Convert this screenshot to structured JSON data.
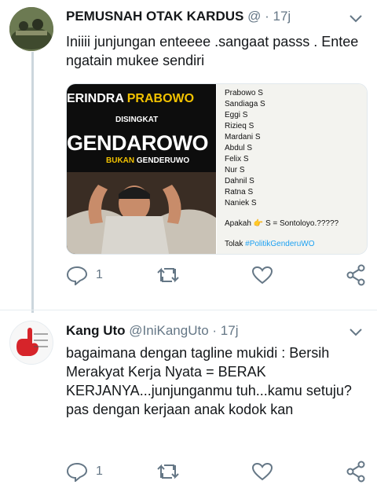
{
  "tweets": [
    {
      "display_name": "PEMUSNAH OTAK KARDUS",
      "handle": "@",
      "sep": "·",
      "time": "17j",
      "text": "Iniiii junjungan enteeee .sangaat passs . Entee ngatain mukee sendiri",
      "media": {
        "left": {
          "erindra": "ERINDRA ",
          "prabowo": "PRABOWO",
          "disingkat": "DISINGKAT",
          "main": "GENDAROWO",
          "bukan": "BUKAN",
          "genderuwo": "GENDERUWO"
        },
        "right": {
          "names": [
            "Prabowo S",
            "Sandiaga S",
            "Eggi S",
            "Rizieq S",
            "Mardani S",
            "Abdul S",
            "Felix S",
            "Nur S",
            "Dahnil S",
            "Ratna S",
            "Naniek S"
          ],
          "question_pre": "Apakah",
          "question_post": "S = Sontoloyo.?????",
          "tolak": "Tolak",
          "hashtag": "#PolitikGenderuWO"
        }
      },
      "reply_count": "1"
    },
    {
      "display_name": "Kang Uto",
      "handle": "@IniKangUto",
      "sep": "·",
      "time": "17j",
      "text": "bagaimana dengan tagline mukidi : Bersih Merakyat Kerja Nyata = BERAK KERJANYA...junjunganmu tuh...kamu setuju? pas dengan kerjaan anak kodok kan",
      "reply_count": "1"
    }
  ],
  "colors": {
    "hashtag": "#1da1f2",
    "secondary": "#657786",
    "accent_yellow": "#f2c200"
  },
  "icons": [
    "reply-icon",
    "retweet-icon",
    "like-icon",
    "share-icon",
    "chevron-down-icon"
  ]
}
